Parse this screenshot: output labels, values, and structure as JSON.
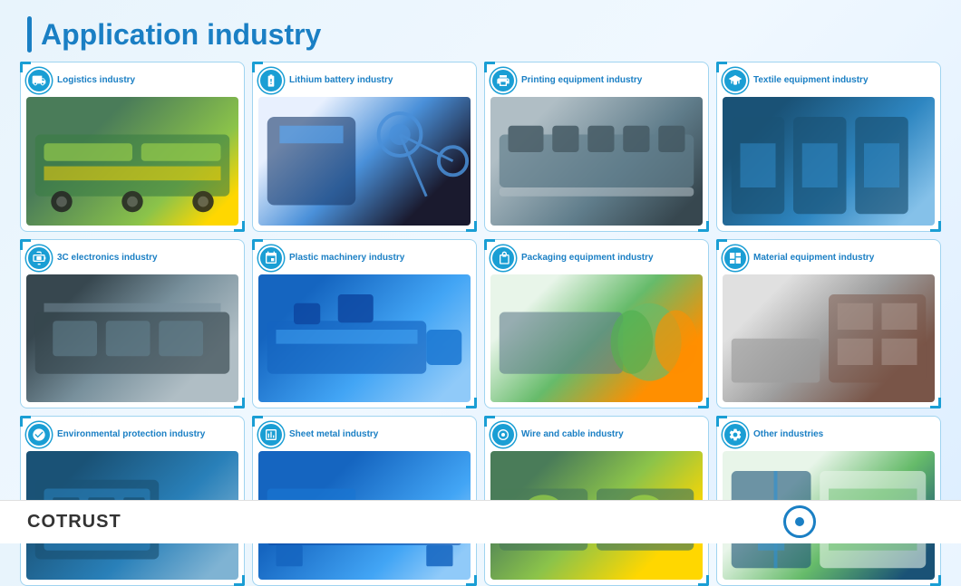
{
  "header": {
    "title": "Application industry",
    "bar_color": "#1a7fc4"
  },
  "footer": {
    "logo_co": "CO",
    "logo_trust": "TRUST"
  },
  "industries": [
    {
      "id": "logistics",
      "label": "Logistics industry",
      "icon": "logistics",
      "img_class": "img-logistics",
      "row": 1,
      "col": 1
    },
    {
      "id": "lithium",
      "label": "Lithium battery industry",
      "icon": "battery",
      "img_class": "img-lithium",
      "row": 1,
      "col": 2
    },
    {
      "id": "printing",
      "label": "Printing equipment industry",
      "icon": "print",
      "img_class": "img-printing",
      "row": 1,
      "col": 3
    },
    {
      "id": "textile",
      "label": "Textile equipment industry",
      "icon": "textile",
      "img_class": "img-textile",
      "row": 1,
      "col": 4
    },
    {
      "id": "3c",
      "label": "3C electronics industry",
      "icon": "chip",
      "img_class": "img-3c",
      "row": 2,
      "col": 1
    },
    {
      "id": "plastic",
      "label": "Plastic machinery industry",
      "icon": "plastic",
      "img_class": "img-plastic",
      "row": 2,
      "col": 2
    },
    {
      "id": "packaging",
      "label": "Packaging equipment industry",
      "icon": "packaging",
      "img_class": "img-packaging",
      "row": 2,
      "col": 3
    },
    {
      "id": "material",
      "label": "Material equipment industry",
      "icon": "material",
      "img_class": "img-material",
      "row": 2,
      "col": 4
    },
    {
      "id": "enviro",
      "label": "Environmental protection industry",
      "icon": "enviro",
      "img_class": "img-enviro",
      "row": 3,
      "col": 1
    },
    {
      "id": "sheetmetal",
      "label": "Sheet metal industry",
      "icon": "metal",
      "img_class": "img-sheetmetal",
      "row": 3,
      "col": 2
    },
    {
      "id": "wire",
      "label": "Wire and cable industry",
      "icon": "wire",
      "img_class": "img-wire",
      "row": 3,
      "col": 3
    },
    {
      "id": "other",
      "label": "Other industries",
      "icon": "gear",
      "img_class": "img-other",
      "row": 3,
      "col": 4
    }
  ]
}
